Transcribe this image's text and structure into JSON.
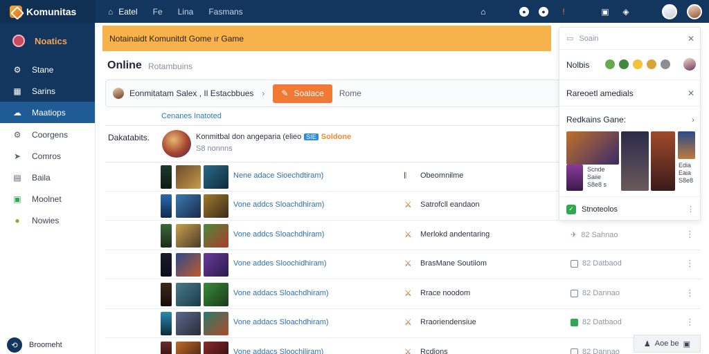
{
  "brand": {
    "name": "Komunitas"
  },
  "topnav": {
    "home": "Eatel",
    "item2": "Fe",
    "item3": "Lina",
    "item4": "Fasmans"
  },
  "sidebar": {
    "header": "Noatics",
    "items": [
      {
        "label": "Stane"
      },
      {
        "label": "Sarins"
      },
      {
        "label": "Maatiops"
      },
      {
        "label": "Coorgens"
      },
      {
        "label": "Comros"
      },
      {
        "label": "Baila"
      },
      {
        "label": "Moolnet"
      },
      {
        "label": "Nowies"
      }
    ],
    "footer": "Broomeht"
  },
  "banner": {
    "text": "Notainaidt Komunitdt Gome ır Game"
  },
  "main": {
    "title": "Online",
    "subtitle": "Rotambuins",
    "filter": {
      "text": "Eonmitatam Salex , Il Estacbbues",
      "button": "Soalace",
      "home": "Rome"
    },
    "link": "Cenanes Inatoted",
    "featured": {
      "label": "Dakatabits.",
      "title": "Konmitbal don angeparia (elieo",
      "tag": "SIE",
      "tag2": "Soldone",
      "sub": "S8 nonnns"
    },
    "rows": [
      {
        "title": "Nene adace Sioechdtiram)",
        "name": "Obeomnilme",
        "stat": ""
      },
      {
        "title": "Vone addcs Sloachdhiram)",
        "name": "Satrofcll eandaon",
        "stat": ""
      },
      {
        "title": "Vone addcs Sloachdhiram)",
        "name": "Merlokd andentaring",
        "stat": "82 Sahnao"
      },
      {
        "title": "Vone addes Sloochidhiram)",
        "name": "BrasMane Soutiiom",
        "stat": "82 Datbaod"
      },
      {
        "title": "Vone addacs Sloachdhiram)",
        "name": "Rrace noodom",
        "stat": "82 Dannao"
      },
      {
        "title": "Vone addacs Sloachdhiram)",
        "name": "Rraoriendensiue",
        "stat": "82 Datbaod"
      },
      {
        "title": "Vone addacs Sloochiliram)",
        "name": "Rcdions",
        "stat": "82 Dannao"
      }
    ]
  },
  "panel": {
    "search": "Soain",
    "header": "Nolbis",
    "row1": "Rareoetl amedials",
    "row2": "Redkains Gane:",
    "caption1": "Scnde\nSaiie\nS8e8 s",
    "caption2": "Edia\nEaia\nS8e8",
    "footer": "Stnoteolos"
  },
  "bottom": {
    "label": "Aoe be"
  }
}
